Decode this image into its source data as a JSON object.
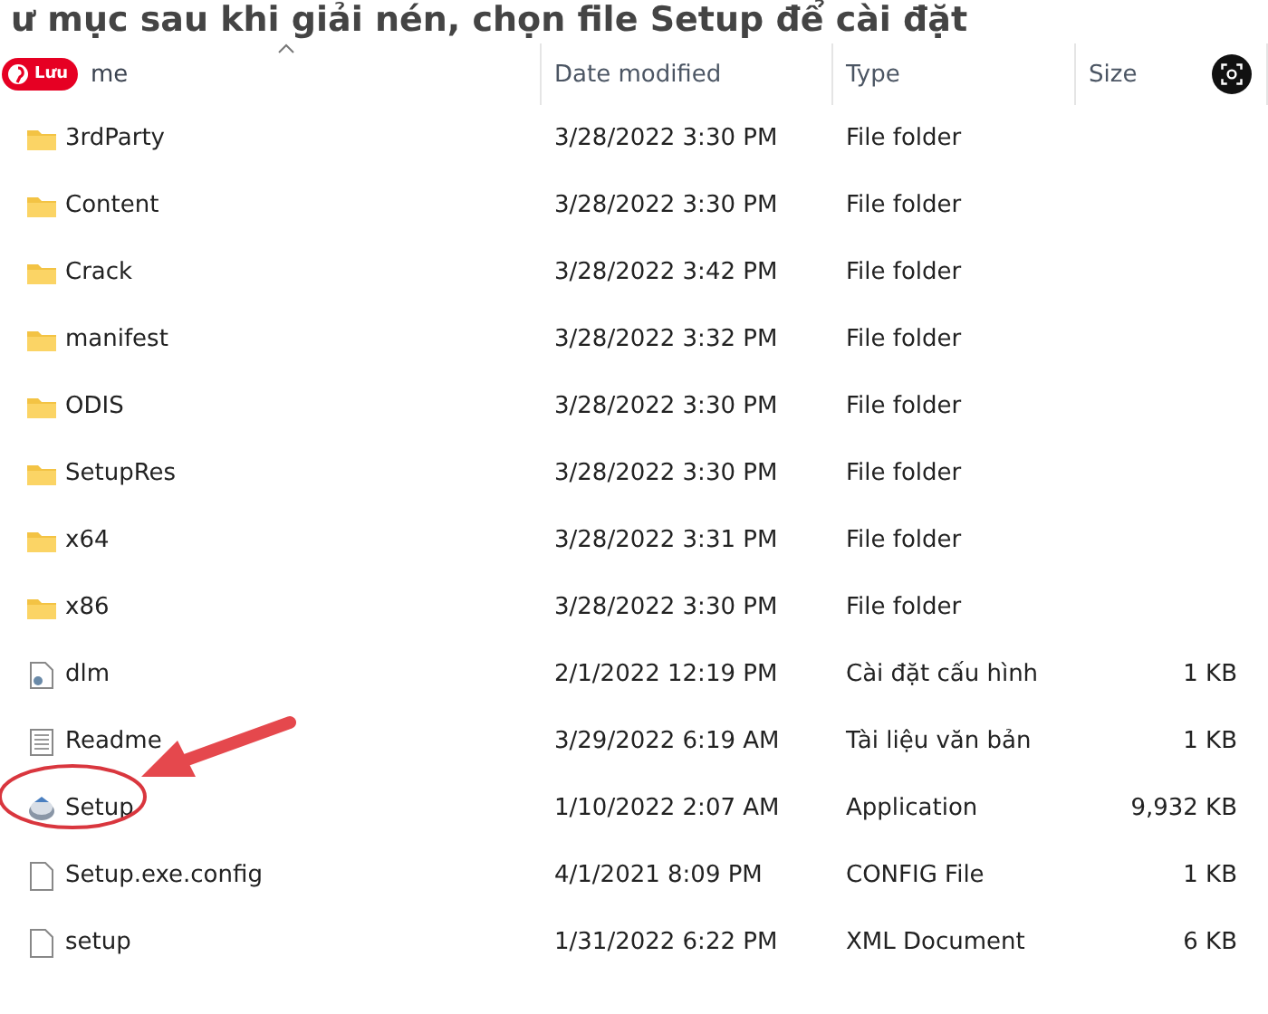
{
  "caption": "ư mục sau khi giải nén, chọn file Setup để cài đặt",
  "save_button": {
    "label": "Lưu"
  },
  "columns": [
    {
      "label": "me",
      "sorted": true
    },
    {
      "label": "Date modified",
      "sorted": false
    },
    {
      "label": "Type",
      "sorted": false
    },
    {
      "label": "Size",
      "sorted": false
    }
  ],
  "rows": [
    {
      "kind": "folder",
      "name": "3rdParty",
      "date": "3/28/2022 3:30 PM",
      "type": "File folder",
      "highlighted": false
    },
    {
      "kind": "folder",
      "name": "Content",
      "date": "3/28/2022 3:30 PM",
      "type": "File folder",
      "highlighted": false
    },
    {
      "kind": "folder",
      "name": "Crack",
      "date": "3/28/2022 3:42 PM",
      "type": "File folder",
      "highlighted": false
    },
    {
      "kind": "folder",
      "name": "manifest",
      "date": "3/28/2022 3:32 PM",
      "type": "File folder",
      "highlighted": false
    },
    {
      "kind": "folder",
      "name": "ODIS",
      "date": "3/28/2022 3:30 PM",
      "type": "File folder",
      "highlighted": false
    },
    {
      "kind": "folder",
      "name": "SetupRes",
      "date": "3/28/2022 3:30 PM",
      "type": "File folder",
      "highlighted": false
    },
    {
      "kind": "folder",
      "name": "x64",
      "date": "3/28/2022 3:31 PM",
      "type": "File folder",
      "highlighted": false
    },
    {
      "kind": "folder",
      "name": "x86",
      "date": "3/28/2022 3:30 PM",
      "type": "File folder",
      "highlighted": false
    },
    {
      "kind": "config",
      "name": "dlm",
      "date": "2/1/2022 12:19 PM",
      "type": "Cài đặt cấu hình",
      "size": "1 KB",
      "highlighted": false
    },
    {
      "kind": "text",
      "name": "Readme",
      "date": "3/29/2022 6:19 AM",
      "type": "Tài liệu văn bản",
      "size": "1 KB",
      "highlighted": false
    },
    {
      "kind": "app",
      "name": "Setup",
      "date": "1/10/2022 2:07 AM",
      "type": "Application",
      "size": "9,932 KB",
      "highlighted": true
    },
    {
      "kind": "blank",
      "name": "Setup.exe.config",
      "date": "4/1/2021 8:09 PM",
      "type": "CONFIG File",
      "size": "1 KB",
      "highlighted": false
    },
    {
      "kind": "blank",
      "name": "setup",
      "date": "1/31/2022 6:22 PM",
      "type": "XML Document",
      "size": "6 KB",
      "highlighted": false
    }
  ]
}
